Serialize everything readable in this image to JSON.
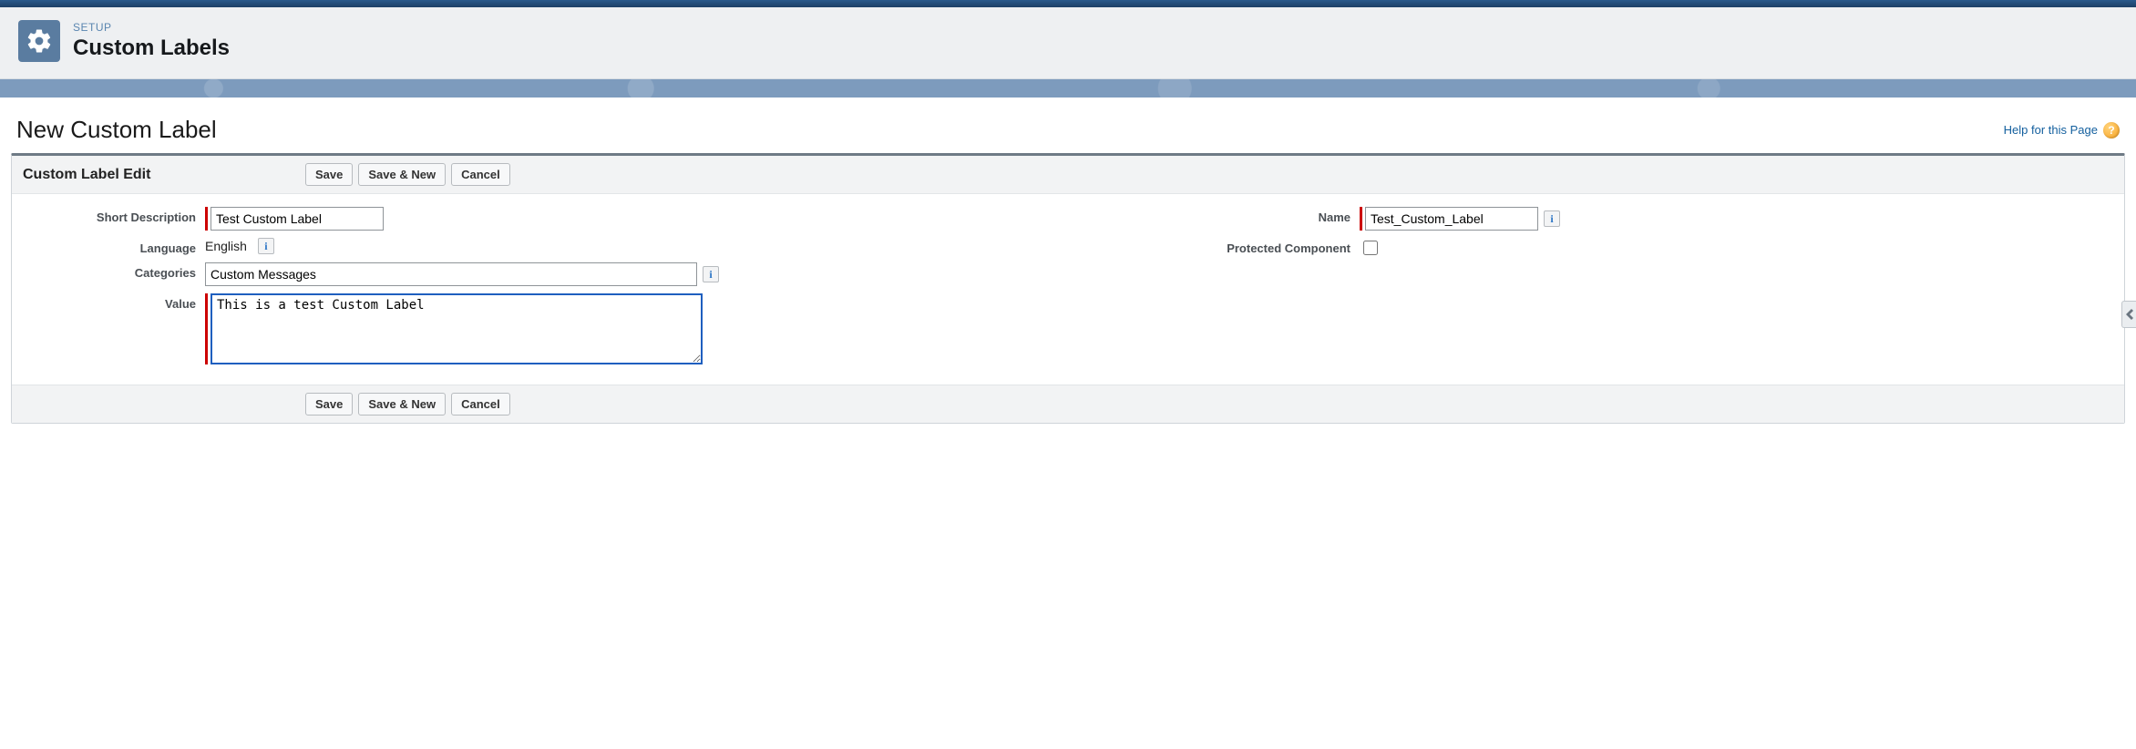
{
  "header": {
    "crumb": "SETUP",
    "title": "Custom Labels"
  },
  "page": {
    "title": "New Custom Label",
    "help_label": "Help for this Page"
  },
  "edit": {
    "section_title": "Custom Label Edit",
    "buttons": {
      "save": "Save",
      "save_new": "Save & New",
      "cancel": "Cancel"
    },
    "labels": {
      "short_desc": "Short Description",
      "language": "Language",
      "categories": "Categories",
      "value": "Value",
      "name": "Name",
      "protected": "Protected Component"
    },
    "values": {
      "short_desc": "Test Custom Label",
      "language": "English",
      "categories": "Custom Messages",
      "value": "This is a test Custom Label",
      "name": "Test_Custom_Label",
      "protected": false
    }
  }
}
